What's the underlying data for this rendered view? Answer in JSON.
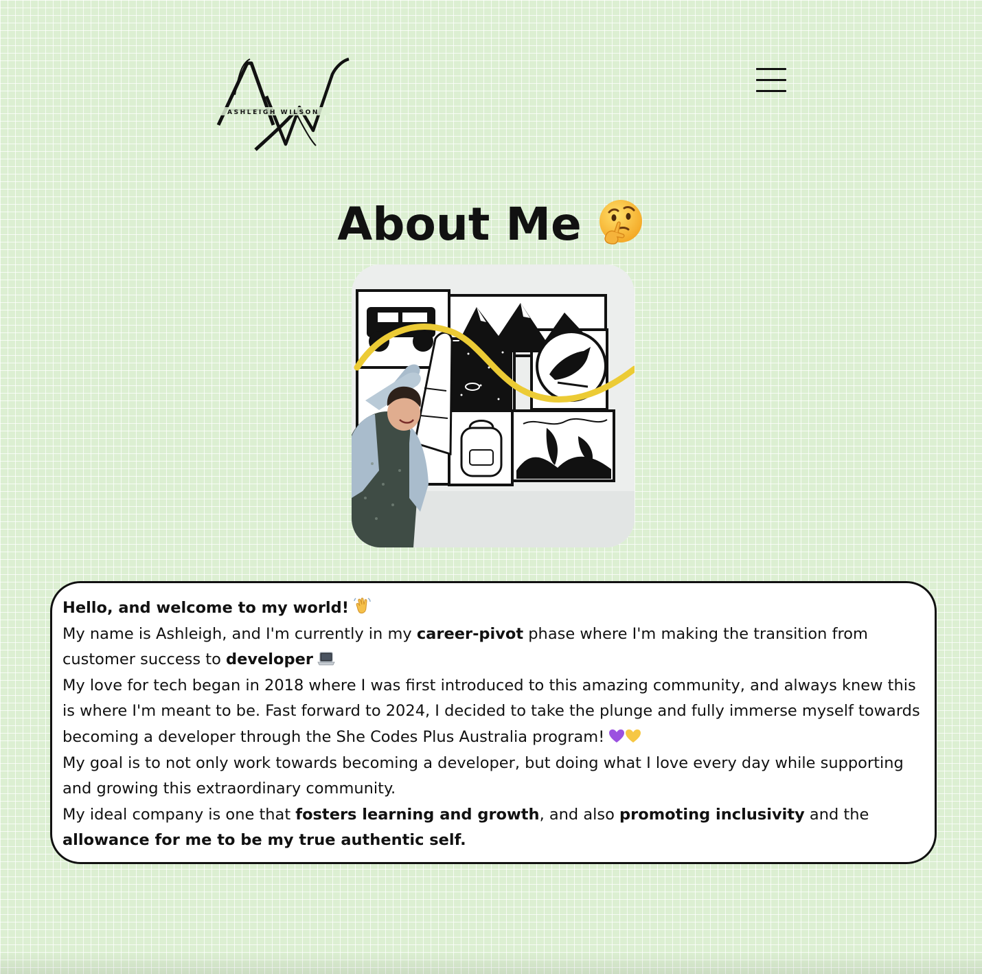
{
  "header": {
    "logo": {
      "monogram": "AW",
      "name_text": "ASHLEIGH WILSON",
      "icon": "aw-monogram-logo"
    },
    "menu_icon": "hamburger-menu-icon"
  },
  "main": {
    "title": "About Me",
    "title_emoji": "thinking-face-emoji",
    "photo_icon": "profile-photo",
    "about": {
      "greeting": "Hello, and welcome to my world!",
      "greeting_emoji": "waving-hand-emoji",
      "p1_start": "My name is Ashleigh, and I'm currently in my ",
      "p1_bold1": "career-pivot",
      "p1_mid": " phase where I'm making the transition from customer success to ",
      "p1_bold2": "developer",
      "p1_emoji": "laptop-emoji",
      "p2": "My love for tech began in 2018 where I was first introduced to this amazing community, and always knew this is where I'm meant to be. Fast forward to 2024, I decided to take the plunge and fully immerse myself towards becoming a developer through the She Codes Plus Australia program!",
      "p2_emojis": [
        "purple-heart-emoji",
        "yellow-heart-emoji"
      ],
      "p3": "My goal is to not only work towards becoming a developer, but doing what I love every day while supporting and growing this extraordinary community.",
      "p4_start": "My ideal company is one that ",
      "p4_bold1": "fosters learning and growth",
      "p4_mid": ", and also ",
      "p4_bold2": "promoting inclusivity",
      "p4_end": " and the ",
      "p4_bold3": "allowance for me to be my true authentic self."
    }
  },
  "colors": {
    "background": "#dcefd2",
    "grid_lines": "#ffffff",
    "text": "#111111",
    "card_background": "#ffffff",
    "card_border": "#111111",
    "purple_heart": "#9b51e0",
    "yellow_heart": "#f6c744",
    "mural_accent": "#eccb35"
  }
}
